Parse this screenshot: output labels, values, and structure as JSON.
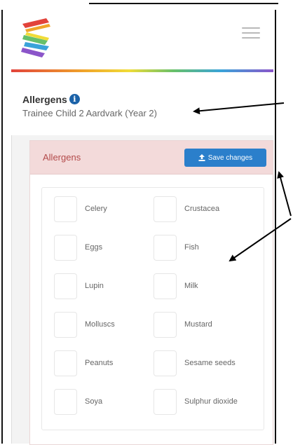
{
  "header": {
    "logo_icon": "stripes-logo-icon",
    "menu_icon": "hamburger-menu-icon"
  },
  "page": {
    "title": "Allergens",
    "info_icon": "i",
    "child_name": "Trainee Child 2 Aardvark (Year 2)"
  },
  "panel": {
    "title": "Allergens",
    "save_label": "Save changes",
    "save_icon": "upload-icon"
  },
  "allergens": [
    {
      "label": "Celery",
      "checked": false
    },
    {
      "label": "Crustacea",
      "checked": false
    },
    {
      "label": "Eggs",
      "checked": false
    },
    {
      "label": "Fish",
      "checked": false
    },
    {
      "label": "Lupin",
      "checked": false
    },
    {
      "label": "Milk",
      "checked": false
    },
    {
      "label": "Molluscs",
      "checked": false
    },
    {
      "label": "Mustard",
      "checked": false
    },
    {
      "label": "Peanuts",
      "checked": false
    },
    {
      "label": "Sesame seeds",
      "checked": false
    },
    {
      "label": "Soya",
      "checked": false
    },
    {
      "label": "Sulphur dioxide",
      "checked": false
    }
  ],
  "colors": {
    "brand_blue": "#2b7fcb",
    "panel_header": "#f3dada",
    "panel_title": "#b34a4a"
  }
}
